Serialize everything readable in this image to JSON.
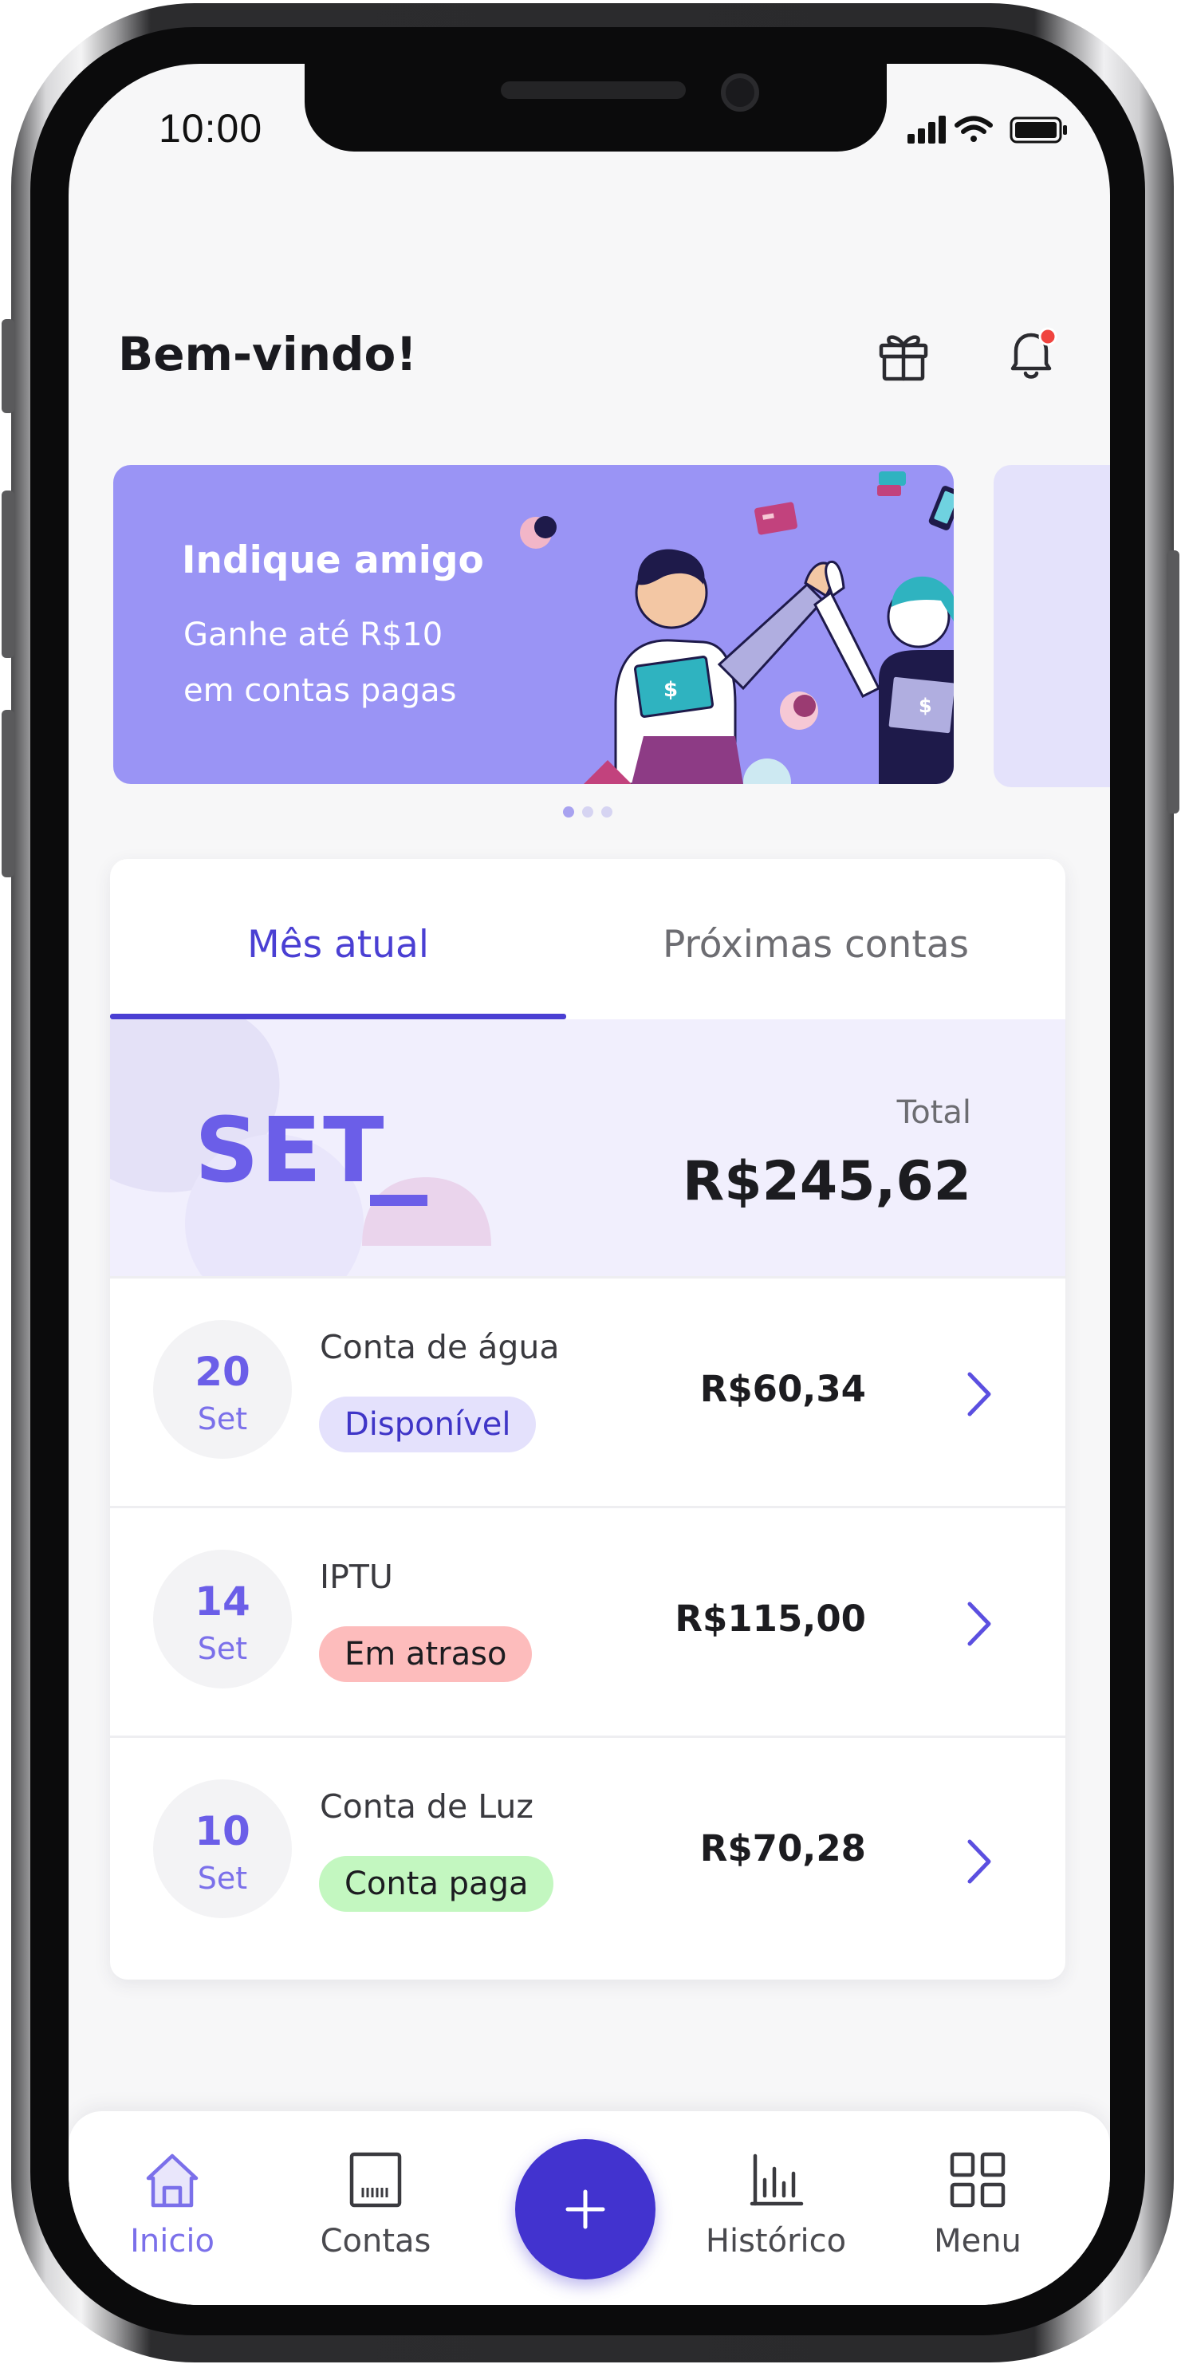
{
  "status_bar": {
    "time": "10:00"
  },
  "header": {
    "title": "Bem-vindo!",
    "gift_icon": "gift-icon",
    "bell_icon": "bell-icon"
  },
  "banner": {
    "title": "Indique amigo",
    "text_line1": "Ganhe até R$10",
    "text_line2": "em contas pagas",
    "carousel_index": 1,
    "carousel_total": 3
  },
  "bills": {
    "tabs": [
      {
        "label": "Mês atual",
        "active": true
      },
      {
        "label": "Próximas contas",
        "active": false
      }
    ],
    "month_code": "SET",
    "total_label": "Total",
    "total_value": "R$245,62",
    "items": [
      {
        "day": "20",
        "month": "Set",
        "name": "Conta de água",
        "status": "Disponível",
        "amount": "R$60,34"
      },
      {
        "day": "14",
        "month": "Set",
        "name": "IPTU",
        "status": "Em atraso",
        "amount": "R$115,00"
      },
      {
        "day": "10",
        "month": "Set",
        "name": "Conta de Luz",
        "status": "Conta paga",
        "amount": "R$70,28"
      }
    ]
  },
  "nav": {
    "items": [
      {
        "label": "Inicio",
        "icon": "home-icon",
        "active": true
      },
      {
        "label": "Contas",
        "icon": "bill-icon",
        "active": false
      },
      {
        "label": "Histórico",
        "icon": "chart-icon",
        "active": false
      },
      {
        "label": "Menu",
        "icon": "grid-icon",
        "active": false
      }
    ],
    "add_icon": "plus-icon"
  },
  "colors": {
    "accent": "#4a3fd3",
    "accent_light": "#6b5ee8",
    "banner": "#9a94f5",
    "status_available_bg": "#e4e1fc",
    "status_available_text": "#3f35c7",
    "status_late_bg": "#fdbcbc",
    "status_late_text": "#1c1c20",
    "status_paid_bg": "#c3f7c0",
    "status_paid_text": "#1c1c20",
    "notification_dot": "#f0443f"
  }
}
